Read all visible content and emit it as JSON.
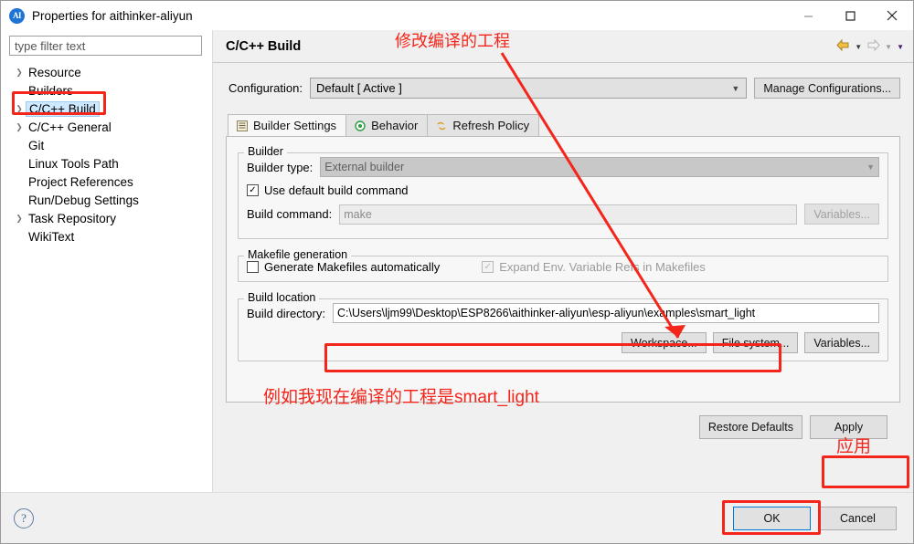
{
  "window": {
    "title": "Properties for aithinker-aliyun",
    "app_icon": "AI",
    "controls": {
      "minimize": "—",
      "maximize": "☐",
      "close": "✕"
    }
  },
  "sidebar": {
    "filter_placeholder": "type filter text",
    "items": [
      {
        "label": "Resource",
        "expandable": true,
        "selected": false
      },
      {
        "label": "Builders",
        "expandable": false,
        "selected": false
      },
      {
        "label": "C/C++ Build",
        "expandable": true,
        "selected": true
      },
      {
        "label": "C/C++ General",
        "expandable": true,
        "selected": false
      },
      {
        "label": "Git",
        "expandable": false,
        "selected": false
      },
      {
        "label": "Linux Tools Path",
        "expandable": false,
        "selected": false
      },
      {
        "label": "Project References",
        "expandable": false,
        "selected": false
      },
      {
        "label": "Run/Debug Settings",
        "expandable": false,
        "selected": false
      },
      {
        "label": "Task Repository",
        "expandable": true,
        "selected": false
      },
      {
        "label": "WikiText",
        "expandable": false,
        "selected": false
      }
    ]
  },
  "page": {
    "title": "C/C++ Build",
    "nav": {
      "back_icon": "back-arrow-icon",
      "forward_icon": "forward-arrow-icon",
      "menu_icon": "dropdown-caret-icon"
    },
    "configuration": {
      "label": "Configuration:",
      "value": "Default  [ Active ]",
      "manage_button": "Manage Configurations..."
    },
    "tabs": [
      {
        "label": "Builder Settings",
        "icon": "list-icon",
        "active": true
      },
      {
        "label": "Behavior",
        "icon": "target-icon",
        "active": false
      },
      {
        "label": "Refresh Policy",
        "icon": "refresh-icon",
        "active": false
      }
    ],
    "builder_group": {
      "title": "Builder",
      "builder_type_label": "Builder type:",
      "builder_type_value": "External builder",
      "use_default_label": "Use default build command",
      "use_default_checked": true,
      "build_command_label": "Build command:",
      "build_command_value": "make",
      "variables_button": "Variables..."
    },
    "makefile_group": {
      "title": "Makefile generation",
      "generate_label": "Generate Makefiles automatically",
      "generate_checked": false,
      "expand_label": "Expand Env. Variable Refs in Makefiles",
      "expand_checked": true
    },
    "build_location_group": {
      "title": "Build location",
      "build_directory_label": "Build directory:",
      "build_directory_value": "C:\\Users\\ljm99\\Desktop\\ESP8266\\aithinker-aliyun\\esp-aliyun\\examples\\smart_light",
      "workspace_button": "Workspace...",
      "filesystem_button": "File system...",
      "variables_button": "Variables..."
    },
    "restore_defaults_button": "Restore Defaults",
    "apply_button": "Apply"
  },
  "footer": {
    "help_icon": "help-icon",
    "ok_button": "OK",
    "cancel_button": "Cancel"
  },
  "annotations": {
    "header_note": "修改编译的工程",
    "path_note": "例如我现在编译的工程是smart_light",
    "apply_note": "应用"
  },
  "colors": {
    "annotation_red": "#f4261b",
    "selection_blue": "#cde8ff",
    "default_button_border": "#0078d7"
  }
}
